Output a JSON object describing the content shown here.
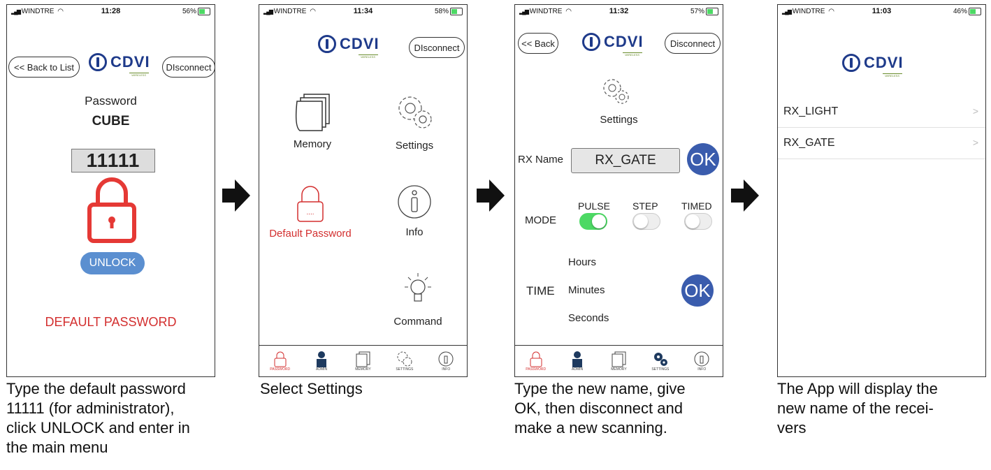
{
  "colors": {
    "accent_blue": "#3a5cad",
    "lock_red": "#e53935",
    "toggle_green": "#4cd964",
    "logo_blue": "#1e3a8a"
  },
  "logo": {
    "word": "CDVI",
    "sub": "WIRELESS"
  },
  "screens": [
    {
      "status": {
        "carrier": "WINDTRE",
        "time": "11:28",
        "battery": "56%"
      },
      "back_button": "<< Back to List",
      "disconnect_button": "DIsconnect",
      "password_label": "Password",
      "device_name": "CUBE",
      "password_value": "11111",
      "unlock_button": "UNLOCK",
      "default_password": "DEFAULT PASSWORD"
    },
    {
      "status": {
        "carrier": "WINDTRE",
        "time": "11:34",
        "battery": "58%"
      },
      "disconnect_button": "DIsconnect",
      "menu": {
        "memory": "Memory",
        "settings": "Settings",
        "default_password": "Default Password",
        "info": "Info",
        "command": "Command"
      },
      "tabs": [
        "PASSWORD",
        "ADMIN",
        "MEMORY",
        "SETTINGS",
        "INFO"
      ]
    },
    {
      "status": {
        "carrier": "WINDTRE",
        "time": "11:32",
        "battery": "57%"
      },
      "back_button": "<< Back",
      "disconnect_button": "Disconnect",
      "settings_label": "Settings",
      "rx_name_label": "RX Name",
      "rx_name_value": "RX_GATE",
      "ok_label": "OK",
      "mode_label": "MODE",
      "modes": [
        {
          "label": "PULSE",
          "on": true
        },
        {
          "label": "STEP",
          "on": false
        },
        {
          "label": "TIMED",
          "on": false
        }
      ],
      "time_label": "TIME",
      "time_units": [
        "Hours",
        "Minutes",
        "Seconds"
      ],
      "tabs": [
        "PASSWORD",
        "ADMIN",
        "MEMORY",
        "SETTINGS",
        "INFO"
      ]
    },
    {
      "status": {
        "carrier": "WINDTRE",
        "time": "11:03",
        "battery": "46%"
      },
      "receivers": [
        "RX_LIGHT",
        "RX_GATE"
      ]
    }
  ],
  "captions": [
    [
      "Type the default password",
      "11111 (for administrator),",
      "click UNLOCK and enter in",
      "the main menu"
    ],
    [
      "Select Settings"
    ],
    [
      "Type the new name, give",
      "OK, then disconnect and",
      "make a new scanning."
    ],
    [
      "The App will display the",
      "new name of the recei-",
      "vers"
    ]
  ]
}
